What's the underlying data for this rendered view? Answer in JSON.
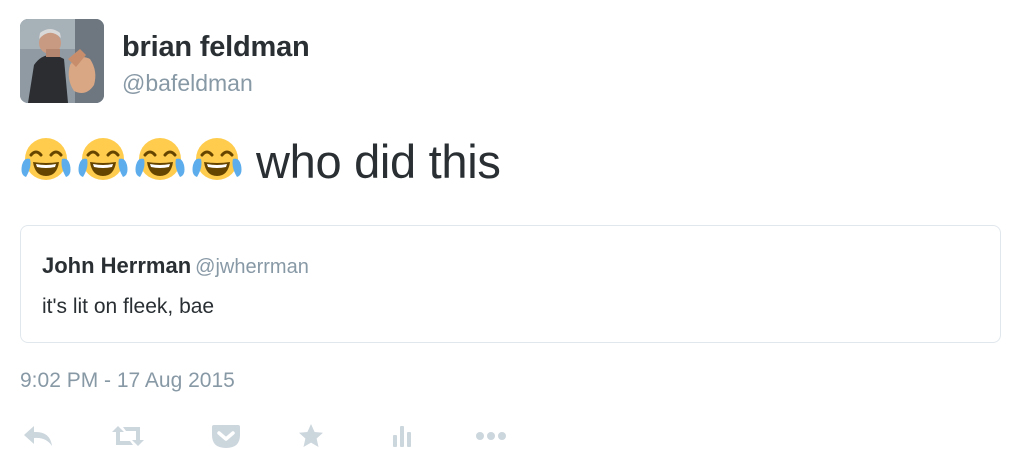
{
  "author": {
    "display_name": "brian feldman",
    "handle": "@bafeldman",
    "avatar_icon": "profile-photo"
  },
  "tweet": {
    "emojis": [
      "face-with-tears-of-joy",
      "face-with-tears-of-joy",
      "face-with-tears-of-joy",
      "face-with-tears-of-joy"
    ],
    "text": "who did this"
  },
  "quoted_tweet": {
    "display_name": "John Herrman",
    "handle": "@jwherrman",
    "text": "it's lit on fleek, bae"
  },
  "timestamp": "9:02 PM - 17 Aug 2015",
  "actions": [
    {
      "name": "reply",
      "icon": "reply-icon"
    },
    {
      "name": "retweet",
      "icon": "retweet-icon"
    },
    {
      "name": "pocket",
      "icon": "pocket-icon"
    },
    {
      "name": "favorite",
      "icon": "star-icon"
    },
    {
      "name": "analytics",
      "icon": "bar-chart-icon"
    },
    {
      "name": "more",
      "icon": "ellipsis-icon"
    }
  ],
  "colors": {
    "text_primary": "#292f33",
    "text_secondary": "#8899a6",
    "icon_gray": "#ccd6dd",
    "border": "#e1e8ed",
    "emoji_face": "#ffcc4d",
    "emoji_tear": "#5dadec"
  }
}
